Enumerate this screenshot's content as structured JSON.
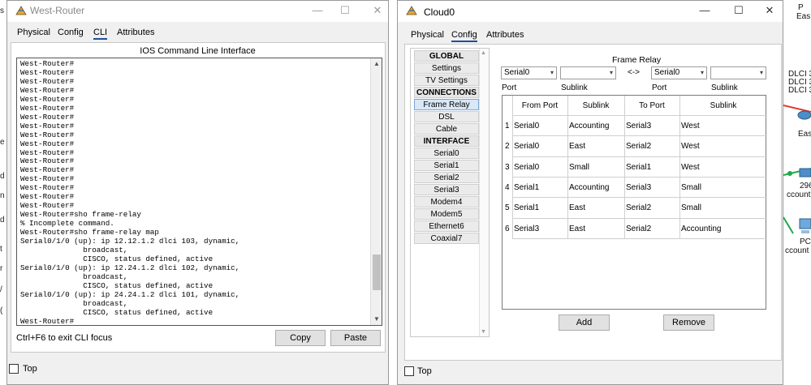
{
  "background": {
    "left_fragments": [
      "s",
      "e",
      "d",
      "n",
      "d",
      "t",
      "r",
      "/",
      "("
    ],
    "right_fragments": [
      "P",
      "Eas",
      "DLCI 3",
      "DLCI 3",
      "DLCI 3",
      "East",
      "296",
      "ccounti",
      "PC",
      "ccount"
    ]
  },
  "west_router": {
    "title": "West-Router",
    "controls": {
      "minimize": "—",
      "maximize": "☐",
      "close": "✕"
    },
    "tabs": [
      "Physical",
      "Config",
      "CLI",
      "Attributes"
    ],
    "active_tab": "CLI",
    "cli_heading": "IOS Command Line Interface",
    "cli_lines": [
      "West-Router#",
      "West-Router#",
      "West-Router#",
      "West-Router#",
      "West-Router#",
      "West-Router#",
      "West-Router#",
      "West-Router#",
      "West-Router#",
      "West-Router#",
      "West-Router#",
      "West-Router#",
      "West-Router#",
      "West-Router#",
      "West-Router#",
      "West-Router#",
      "West-Router#",
      "West-Router#sho frame-relay",
      "% Incomplete command.",
      "West-Router#sho frame-relay map",
      "Serial0/1/0 (up): ip 12.12.1.2 dlci 103, dynamic,",
      "              broadcast,",
      "              CISCO, status defined, active",
      "Serial0/1/0 (up): ip 12.24.1.2 dlci 102, dynamic,",
      "              broadcast,",
      "              CISCO, status defined, active",
      "Serial0/1/0 (up): ip 24.24.1.2 dlci 101, dynamic,",
      "              broadcast,",
      "              CISCO, status defined, active",
      "West-Router#"
    ],
    "scroll_position": 0.88,
    "hint": "Ctrl+F6 to exit CLI focus",
    "copy_label": "Copy",
    "paste_label": "Paste",
    "top_label": "Top",
    "top_checked": false
  },
  "cloud": {
    "title": "Cloud0",
    "controls": {
      "minimize": "—",
      "maximize": "☐",
      "close": "✕"
    },
    "tabs": [
      "Physical",
      "Config",
      "Attributes"
    ],
    "active_tab": "Config",
    "menu": [
      {
        "label": "GLOBAL",
        "type": "header"
      },
      {
        "label": "Settings",
        "type": "item"
      },
      {
        "label": "TV Settings",
        "type": "item"
      },
      {
        "label": "CONNECTIONS",
        "type": "header"
      },
      {
        "label": "Frame Relay",
        "type": "item",
        "selected": true
      },
      {
        "label": "DSL",
        "type": "item"
      },
      {
        "label": "Cable",
        "type": "item"
      },
      {
        "label": "INTERFACE",
        "type": "header"
      },
      {
        "label": "Serial0",
        "type": "item"
      },
      {
        "label": "Serial1",
        "type": "item"
      },
      {
        "label": "Serial2",
        "type": "item"
      },
      {
        "label": "Serial3",
        "type": "item"
      },
      {
        "label": "Modem4",
        "type": "item"
      },
      {
        "label": "Modem5",
        "type": "item"
      },
      {
        "label": "Ethernet6",
        "type": "item"
      },
      {
        "label": "Coaxial7",
        "type": "item"
      }
    ],
    "frame_relay": {
      "title": "Frame Relay",
      "left_port": "Serial0",
      "left_sublink": "",
      "arrow": "<->",
      "right_port": "Serial0",
      "right_sublink": "",
      "port_label": "Port",
      "sublink_label": "Sublink",
      "columns": [
        "From Port",
        "Sublink",
        "To Port",
        "Sublink"
      ],
      "rows": [
        [
          "1",
          "Serial0",
          "Accounting",
          "Serial3",
          "West"
        ],
        [
          "2",
          "Serial0",
          "East",
          "Serial2",
          "West"
        ],
        [
          "3",
          "Serial0",
          "Small",
          "Serial1",
          "West"
        ],
        [
          "4",
          "Serial1",
          "Accounting",
          "Serial3",
          "Small"
        ],
        [
          "5",
          "Serial1",
          "East",
          "Serial2",
          "Small"
        ],
        [
          "6",
          "Serial3",
          "East",
          "Serial2",
          "Accounting"
        ]
      ],
      "add_label": "Add",
      "remove_label": "Remove"
    },
    "top_label": "Top",
    "top_checked": false
  }
}
